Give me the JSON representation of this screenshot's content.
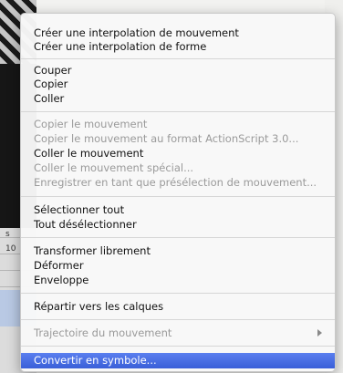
{
  "background": {
    "left_labels": [
      "s",
      "10"
    ]
  },
  "menu": {
    "groups": [
      {
        "items": [
          {
            "label": "Créer une interpolation de mouvement",
            "enabled": true
          },
          {
            "label": "Créer une interpolation de forme",
            "enabled": true
          }
        ]
      },
      {
        "items": [
          {
            "label": "Couper",
            "enabled": true
          },
          {
            "label": "Copier",
            "enabled": true
          },
          {
            "label": "Coller",
            "enabled": true
          }
        ]
      },
      {
        "items": [
          {
            "label": "Copier le mouvement",
            "enabled": false
          },
          {
            "label": "Copier le mouvement au format ActionScript 3.0...",
            "enabled": false
          },
          {
            "label": "Coller le mouvement",
            "enabled": true
          },
          {
            "label": "Coller le mouvement spécial...",
            "enabled": false
          },
          {
            "label": "Enregistrer en tant que présélection de mouvement...",
            "enabled": false
          }
        ]
      },
      {
        "items": [
          {
            "label": "Sélectionner tout",
            "enabled": true
          },
          {
            "label": "Tout désélectionner",
            "enabled": true
          }
        ]
      },
      {
        "items": [
          {
            "label": "Transformer librement",
            "enabled": true
          },
          {
            "label": "Déformer",
            "enabled": true
          },
          {
            "label": "Enveloppe",
            "enabled": true
          }
        ]
      },
      {
        "items": [
          {
            "label": "Répartir vers les calques",
            "enabled": true
          }
        ]
      },
      {
        "items": [
          {
            "label": "Trajectoire du mouvement",
            "enabled": false,
            "submenu": true
          }
        ]
      },
      {
        "items": [
          {
            "label": "Convertir en symbole...",
            "enabled": true,
            "selected": true
          }
        ]
      }
    ],
    "colors": {
      "highlight": "#3f63dc",
      "disabled_text": "#9a9a9a"
    }
  }
}
